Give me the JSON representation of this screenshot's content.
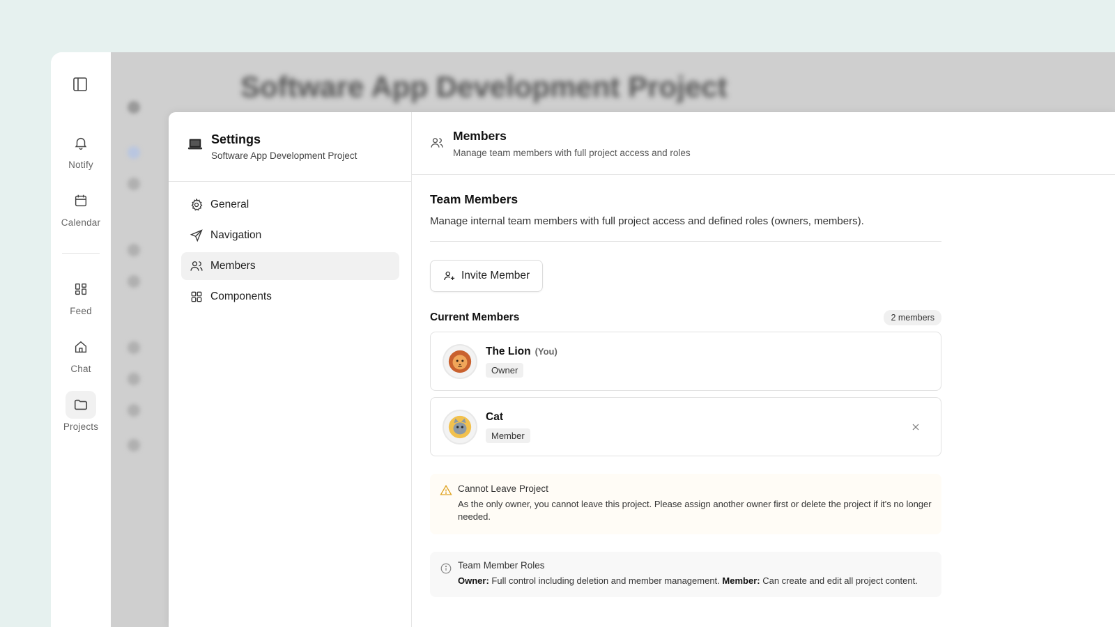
{
  "background": {
    "project_title": "Software App Development Project"
  },
  "rail": {
    "items": [
      {
        "label": "Notify",
        "icon": "bell-icon"
      },
      {
        "label": "Calendar",
        "icon": "calendar-icon"
      },
      {
        "label": "Feed",
        "icon": "grid-icon"
      },
      {
        "label": "Chat",
        "icon": "home-icon"
      },
      {
        "label": "Projects",
        "icon": "folder-icon"
      }
    ]
  },
  "settings": {
    "title": "Settings",
    "subtitle": "Software App Development Project",
    "nav": [
      {
        "label": "General",
        "icon": "gear-icon"
      },
      {
        "label": "Navigation",
        "icon": "send-icon"
      },
      {
        "label": "Members",
        "icon": "users-icon"
      },
      {
        "label": "Components",
        "icon": "grid-icon"
      }
    ]
  },
  "members_page": {
    "title": "Members",
    "subtitle": "Manage team members with full project access and roles",
    "section_title": "Team Members",
    "section_desc": "Manage internal team members with full project access and defined roles (owners, members).",
    "invite_label": "Invite Member",
    "current_title": "Current Members",
    "count": "2 members",
    "members": [
      {
        "name": "The Lion",
        "you": "(You)",
        "role": "Owner",
        "avatar": "lion-avatar"
      },
      {
        "name": "Cat",
        "role": "Member",
        "avatar": "cat-avatar"
      }
    ],
    "warning": {
      "title": "Cannot Leave Project",
      "text": "As the only owner, you cannot leave this project. Please assign another owner first or delete the project if it's no longer needed."
    },
    "roles_info": {
      "title": "Team Member Roles",
      "owner_label": "Owner:",
      "owner_text": "Full control including deletion and member management.",
      "member_label": "Member:",
      "member_text": "Can create and edit all project content."
    }
  },
  "colors": {
    "page_bg": "#e6f1ef",
    "warning": "#e0a526",
    "active_bg": "#f1f1f1"
  }
}
